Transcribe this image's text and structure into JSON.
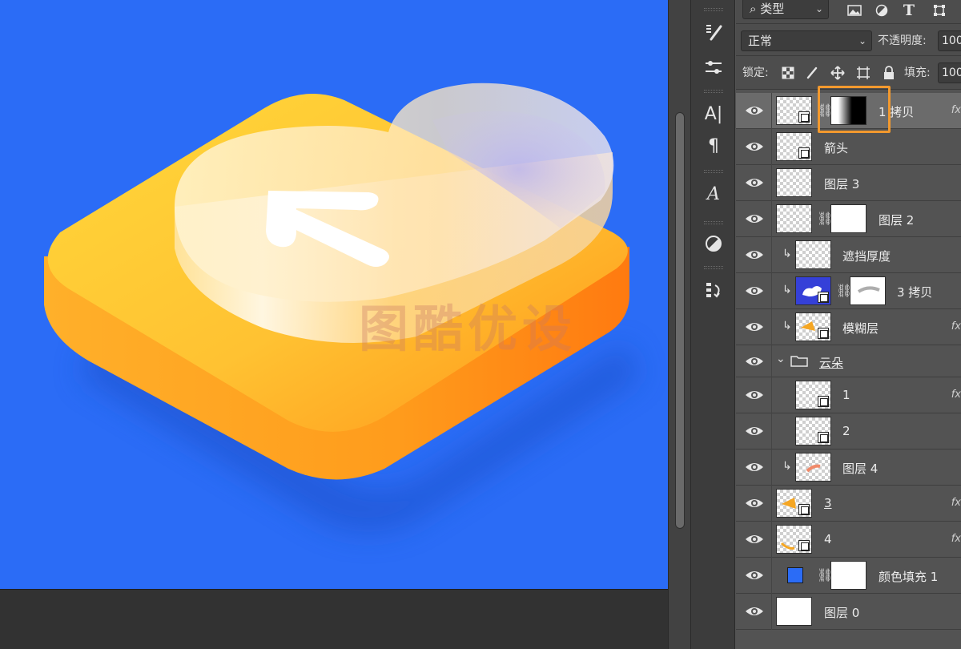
{
  "canvas": {
    "background_color": "#2b6cf6",
    "watermark_text": "图酷优设"
  },
  "toolbar": {
    "filter_type": "类型",
    "blend_mode": "正常",
    "opacity_label": "不透明度:",
    "opacity_value": "100",
    "lock_label": "锁定:",
    "fill_label": "填充:",
    "fill_value": "100",
    "filter_icons": [
      "image-filter-icon",
      "adjustment-filter-icon",
      "type-filter-icon",
      "shape-filter-icon"
    ]
  },
  "tools": [
    "brush-settings-icon",
    "properties-icon",
    "character-icon",
    "paragraph-icon",
    "glyphs-icon",
    "adjustments-icon",
    "history-icon"
  ],
  "layers": [
    {
      "name": "1 拷贝",
      "type": "smart-mask",
      "active": true,
      "fx": "fx"
    },
    {
      "name": "箭头",
      "type": "smart"
    },
    {
      "name": "图层 3",
      "type": "raster"
    },
    {
      "name": "图层 2",
      "type": "mask"
    },
    {
      "name": "遮挡厚度",
      "type": "clip-raster"
    },
    {
      "name": "3 拷贝",
      "type": "clip-smart-mask"
    },
    {
      "name": "模糊层",
      "type": "clip-smart",
      "fx": "fx"
    },
    {
      "name": "云朵",
      "type": "group"
    },
    {
      "name": "1",
      "type": "smart-child",
      "fx": "fx"
    },
    {
      "name": "2",
      "type": "smart-child"
    },
    {
      "name": "图层 4",
      "type": "clip-raster"
    },
    {
      "name": "3",
      "type": "smart",
      "fx": "fx"
    },
    {
      "name": "4",
      "type": "smart",
      "fx": "fx"
    },
    {
      "name": "颜色填充 1",
      "type": "fill"
    },
    {
      "name": "图层 0",
      "type": "plain"
    }
  ],
  "colors": {
    "accent_highlight": "#f2992e",
    "fill_color": "#2b6cf6"
  }
}
